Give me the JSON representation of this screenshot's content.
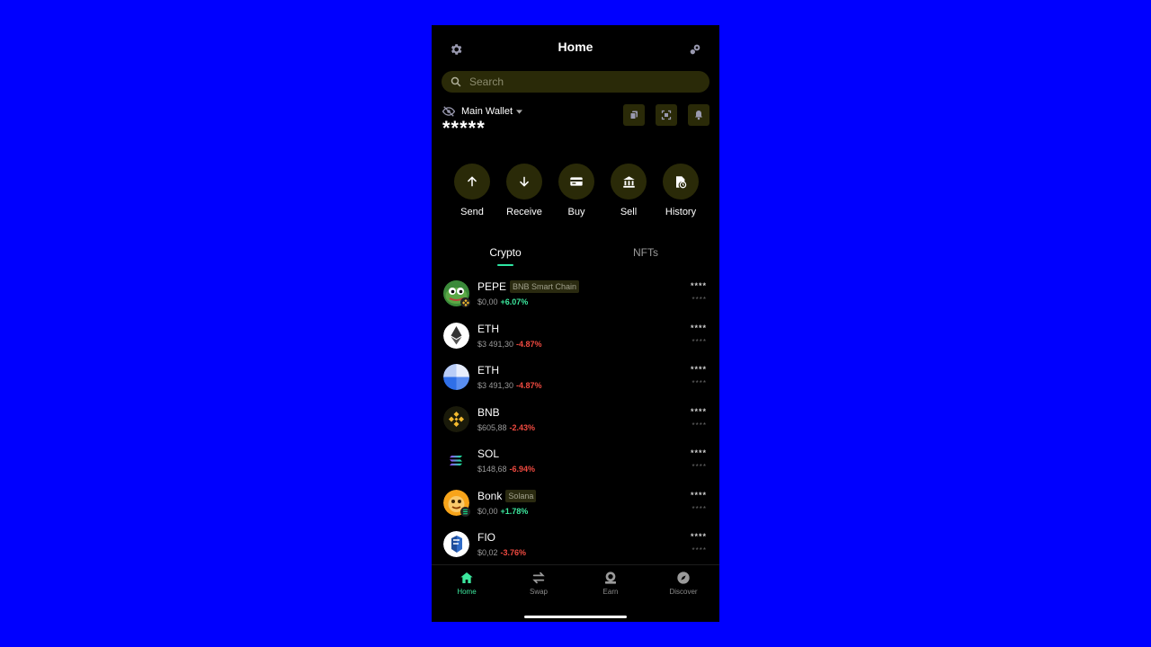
{
  "header": {
    "title": "Home"
  },
  "search": {
    "placeholder": "Search"
  },
  "wallet": {
    "name": "Main Wallet",
    "balance": "*****"
  },
  "actions": [
    {
      "label": "Send"
    },
    {
      "label": "Receive"
    },
    {
      "label": "Buy"
    },
    {
      "label": "Sell"
    },
    {
      "label": "History"
    }
  ],
  "tabs": {
    "crypto": "Crypto",
    "nfts": "NFTs",
    "active": "crypto"
  },
  "assets": [
    {
      "symbol": "PEPE",
      "chain": "BNB Smart Chain",
      "price": "$0,00",
      "change": "+6.07%",
      "direction": "up",
      "amount": "****",
      "fiat": "****"
    },
    {
      "symbol": "ETH",
      "chain": "",
      "price": "$3 491,30",
      "change": "-4.87%",
      "direction": "down",
      "amount": "****",
      "fiat": "****"
    },
    {
      "symbol": "ETH",
      "chain": "",
      "price": "$3 491,30",
      "change": "-4.87%",
      "direction": "down",
      "amount": "****",
      "fiat": "****"
    },
    {
      "symbol": "BNB",
      "chain": "",
      "price": "$605,88",
      "change": "-2.43%",
      "direction": "down",
      "amount": "****",
      "fiat": "****"
    },
    {
      "symbol": "SOL",
      "chain": "",
      "price": "$148,68",
      "change": "-6.94%",
      "direction": "down",
      "amount": "****",
      "fiat": "****"
    },
    {
      "symbol": "Bonk",
      "chain": "Solana",
      "price": "$0,00",
      "change": "+1.78%",
      "direction": "up",
      "amount": "****",
      "fiat": "****"
    },
    {
      "symbol": "FIO",
      "chain": "",
      "price": "$0,02",
      "change": "-3.76%",
      "direction": "down",
      "amount": "****",
      "fiat": "****"
    }
  ],
  "nav": [
    {
      "label": "Home",
      "active": true
    },
    {
      "label": "Swap",
      "active": false
    },
    {
      "label": "Earn",
      "active": false
    },
    {
      "label": "Discover",
      "active": false
    }
  ],
  "colors": {
    "accent": "#3ce89e",
    "negative": "#f04a40",
    "surface": "#2a2a08",
    "background": "#0000ff"
  }
}
